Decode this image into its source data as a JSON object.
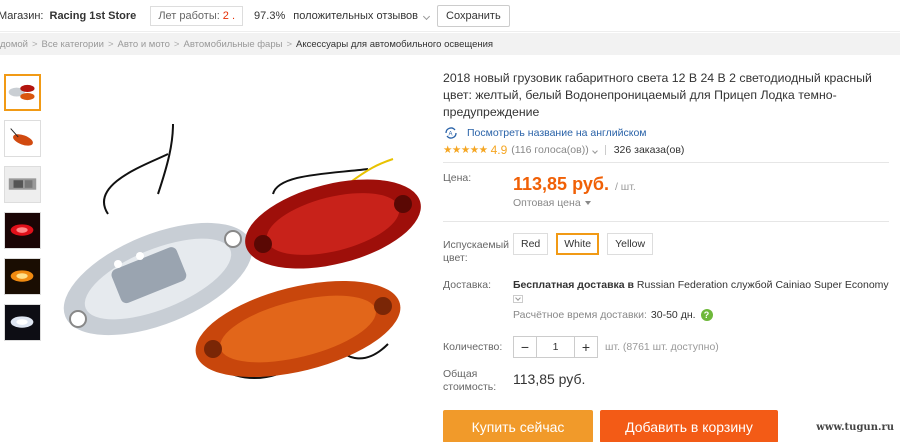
{
  "store": {
    "label": "Магазин:",
    "name": "Racing 1st Store",
    "years_label": "Лет работы:",
    "years_value": "2 .",
    "positive_pct": "97.3%",
    "positive_label": "положительных отзывов",
    "save_label": "Сохранить"
  },
  "breadcrumb": {
    "items": [
      "домой",
      "Все категории",
      "Авто и мото",
      "Автомобильные фары",
      "Аксессуары для автомобильного освещения"
    ],
    "separator": ">"
  },
  "gallery": {
    "thumbnails": [
      "lights-pair",
      "orange-light-side",
      "lights-measured",
      "red-lit",
      "amber-lit",
      "white-lit"
    ],
    "active_index": 0
  },
  "product": {
    "title": "2018 новый грузовик габаритного света 12 В 24 В 2 светодиодный красный цвет: желтый, белый Водонепроницаемый для Прицеп Лодка темно- предупреждение",
    "translate_link": "Посмотреть название на английском",
    "stars": "★★★★★",
    "rating": "4.9",
    "votes": "(116 голоса(ов))",
    "orders": "326 заказа(ов)"
  },
  "price": {
    "label": "Цена:",
    "value": "113,85 руб.",
    "unit": "/ шт.",
    "wholesale": "Оптовая цена"
  },
  "color": {
    "label": "Испускаемый цвет:",
    "options": [
      "Red",
      "White",
      "Yellow"
    ],
    "selected": "White"
  },
  "shipping": {
    "label": "Доставка:",
    "free": "Бесплатная доставка в",
    "country": "Russian Federation",
    "via": "службой",
    "carrier": "Cainiao Super Economy",
    "time_label": "Расчётное время доставки:",
    "time_value": "30-50 дн."
  },
  "quantity": {
    "label": "Количество:",
    "value": "1",
    "minus": "−",
    "plus": "+",
    "stock": "шт. (8761 шт. доступно)"
  },
  "total": {
    "label": "Общая стоимость:",
    "value": "113,85 руб."
  },
  "actions": {
    "buy": "Купить сейчас",
    "cart": "Добавить в корзину"
  },
  "watermark": "www.tugun.ru",
  "colors": {
    "accent_orange": "#f19a2a",
    "cart_red_orange": "#f35b16",
    "price_color": "#f06006",
    "link_blue": "#2962a8",
    "star_color": "#f5a623"
  }
}
